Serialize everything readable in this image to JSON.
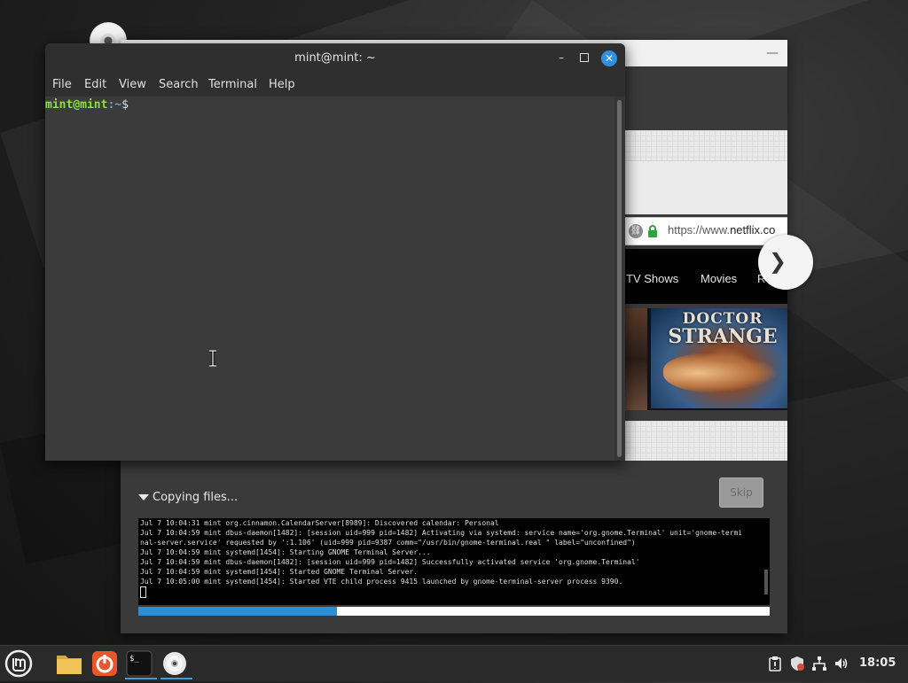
{
  "desktop": {
    "dvd_icon": "dvd-icon"
  },
  "installer": {
    "minimize_glyph": "—",
    "browser_url_prefix": "https://www.",
    "browser_url_domain": "netflix.co",
    "nav_items": [
      "TV Shows",
      "Movies",
      "R"
    ],
    "next_glyph": "❯",
    "poster_title_line1": "DOCTOR",
    "poster_title_line2": "STRANGE",
    "status_label": "Copying files...",
    "skip_label": "Skip",
    "progress_fraction": 0.315,
    "log_lines": [
      "Jul  7 10:04:31 mint org.cinnamon.CalendarServer[8989]: Discovered calendar:  Personal",
      "Jul  7 10:04:59 mint dbus-daemon[1482]: [session uid=999 pid=1482] Activating via systemd: service name='org.gnome.Terminal' unit='gnome-termi",
      "nal-server.service' requested by ':1.106' (uid=999 pid=9387 comm=\"/usr/bin/gnome-terminal.real \" label=\"unconfined\")",
      "Jul  7 10:04:59 mint systemd[1454]: Starting GNOME Terminal Server...",
      "Jul  7 10:04:59 mint dbus-daemon[1482]: [session uid=999 pid=1482] Successfully activated service 'org.gnome.Terminal'",
      "Jul  7 10:04:59 mint systemd[1454]: Started GNOME Terminal Server.",
      "Jul  7 10:05:00 mint systemd[1454]: Started VTE child process 9415 launched by gnome-terminal-server process 9390."
    ],
    "colors": {
      "progress": "#2a8fd4"
    }
  },
  "terminal": {
    "title": "mint@mint: ~",
    "minimize_glyph": "–",
    "close_glyph": "✕",
    "menu": [
      "File",
      "Edit",
      "View",
      "Search",
      "Terminal",
      "Help"
    ],
    "prompt_user": "mint@mint",
    "prompt_path": ":~",
    "prompt_symbol": "$",
    "colors": {
      "prompt_user": "#8ae234",
      "prompt_path": "#729fcf",
      "close_button": "#2f8fe0"
    }
  },
  "taskbar": {
    "items": [
      "mint-menu-icon",
      "files-icon",
      "installer-icon",
      "terminal-icon",
      "dvd-icon"
    ],
    "terminal_glyph": "$_",
    "tray": [
      "clipboard-icon",
      "update-shield-icon",
      "network-icon",
      "volume-icon"
    ],
    "clock": "18:05"
  }
}
